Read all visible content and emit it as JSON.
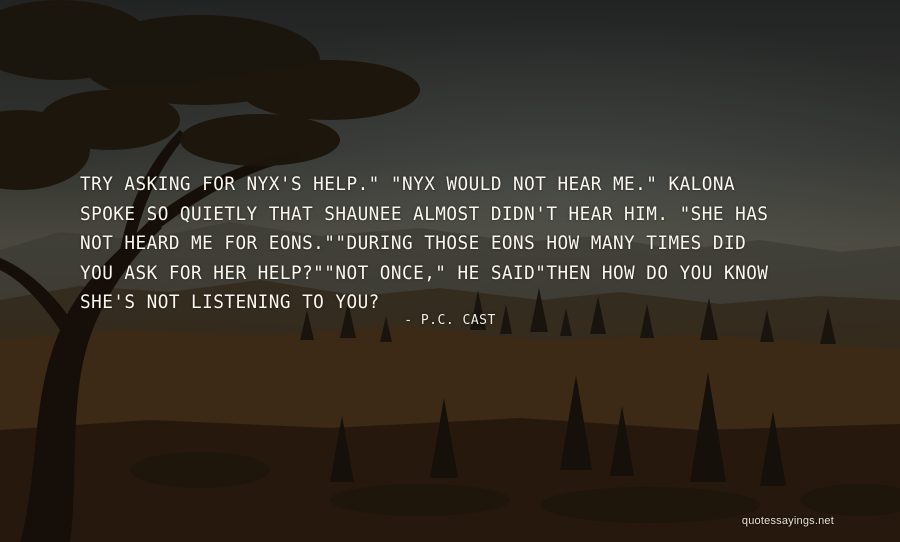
{
  "quote": {
    "text": "Try asking for Nyx's help.\" \"Nyx would not hear me.\" Kalona spoke so quietly that Shaunee almost didn't hear him. \"She has not heard me for eons.\"\"During those eons how many times did you ask for her help?\"\"Not once,\" he said\"Then how do you know she's not listening to you?",
    "author": "- P.C. Cast"
  },
  "watermark": "quotessayings.net",
  "colors": {
    "text": "#fbf7ee",
    "sky_top": "#2a2c2c",
    "horizon_glow": "#8a8a80",
    "ground": "#2a1c10"
  }
}
